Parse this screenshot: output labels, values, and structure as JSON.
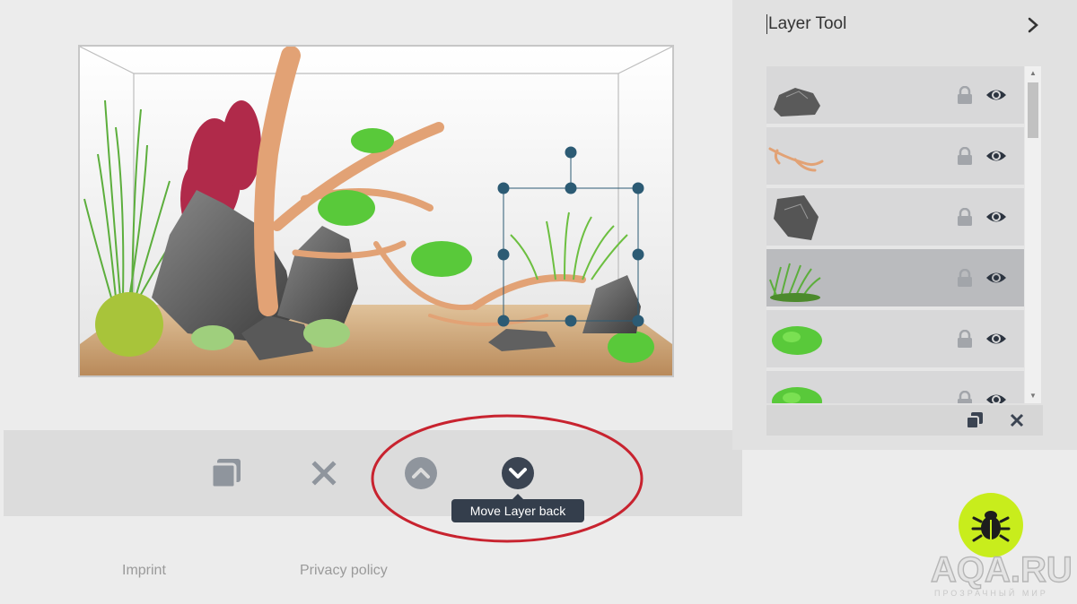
{
  "canvas": {
    "tank_label": "aquarium-scape"
  },
  "toolbar": {
    "duplicate": "duplicate",
    "delete": "delete",
    "move_forward": "move layer forward",
    "move_back": "move layer back",
    "tooltip": "Move Layer back"
  },
  "footer": {
    "imprint": "Imprint",
    "privacy": "Privacy policy"
  },
  "panel": {
    "title": "Layer Tool",
    "layers": [
      {
        "thumb": "grey-stone",
        "locked": false,
        "visible": true,
        "selected": false
      },
      {
        "thumb": "driftwood-root",
        "locked": false,
        "visible": true,
        "selected": false
      },
      {
        "thumb": "tall-stone",
        "locked": false,
        "visible": true,
        "selected": false
      },
      {
        "thumb": "grass-plant",
        "locked": false,
        "visible": true,
        "selected": true
      },
      {
        "thumb": "moss-ball",
        "locked": false,
        "visible": true,
        "selected": false
      },
      {
        "thumb": "moss-ball",
        "locked": false,
        "visible": true,
        "selected": false
      }
    ]
  },
  "watermark": {
    "brand": "AQA.RU",
    "tagline": "ПРОЗРАЧНЫЙ МИР"
  },
  "colors": {
    "accent": "#c8ed1c",
    "tooltip_bg": "#343e4c",
    "icon_grey": "#8f959d",
    "icon_dark": "#3b4452",
    "annotation": "#c8232f"
  }
}
